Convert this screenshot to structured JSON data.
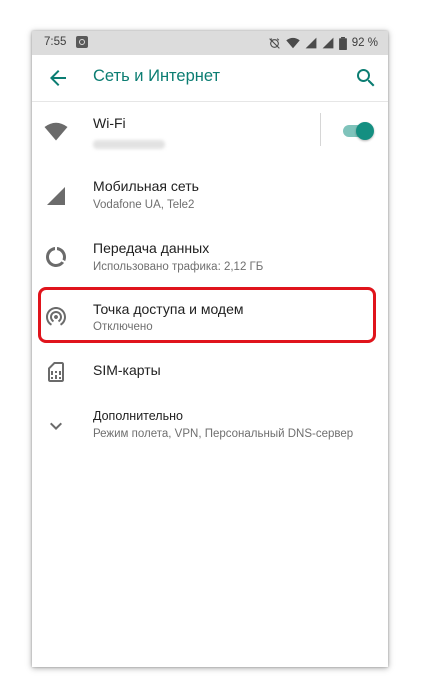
{
  "status_bar": {
    "time": "7:55",
    "battery": "92 %"
  },
  "header": {
    "title": "Сеть и Интернет",
    "back_icon": "arrow-left-icon",
    "search_icon": "search-icon"
  },
  "items": [
    {
      "icon": "wifi-icon",
      "title": "Wi-Fi",
      "subtitle": "",
      "toggle_on": true
    },
    {
      "icon": "cellular-signal-icon",
      "title": "Мобильная сеть",
      "subtitle": "Vodafone UA, Tele2"
    },
    {
      "icon": "data-usage-icon",
      "title": "Передача данных",
      "subtitle": "Использовано трафика: 2,12 ГБ"
    },
    {
      "icon": "hotspot-icon",
      "title": "Точка доступа и модем",
      "subtitle": "Отключено",
      "highlighted": true
    },
    {
      "icon": "sim-card-icon",
      "title": "SIM-карты",
      "subtitle": ""
    },
    {
      "icon": "chevron-down-icon",
      "title": "Дополнительно",
      "subtitle": "Режим полета, VPN, Персональный DNS-сервер"
    }
  ],
  "colors": {
    "accent": "#0b7d72",
    "toggle_thumb": "#148f81",
    "highlight": "#e0141c",
    "status_bar_bg": "#dcdcdc"
  }
}
